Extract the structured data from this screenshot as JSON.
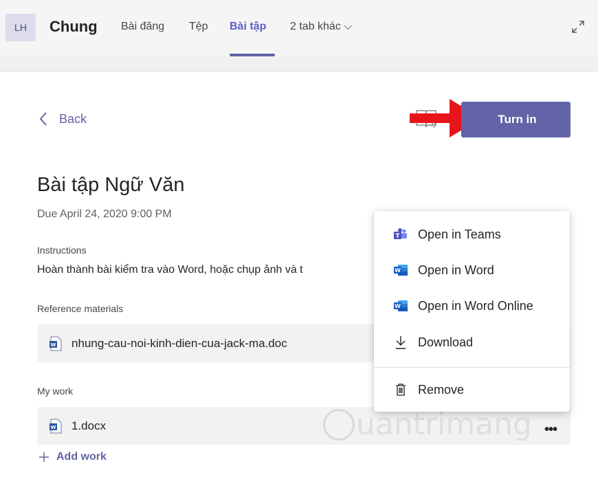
{
  "header": {
    "avatar_initials": "LH",
    "channel_title": "Chung",
    "tabs": [
      {
        "label": "Bài đăng",
        "active": false
      },
      {
        "label": "Tệp",
        "active": false
      },
      {
        "label": "Bài tập",
        "active": true
      },
      {
        "label": "2 tab khác ⌵",
        "active": false
      }
    ]
  },
  "toolbar": {
    "back_label": "Back",
    "turn_in_label": "Turn in"
  },
  "assignment": {
    "title": "Bài tập Ngữ Văn",
    "due": "Due April 24, 2020 9:00 PM",
    "instructions_label": "Instructions",
    "instructions_text": "Hoàn thành bài kiểm tra vào Word, hoặc chụp ảnh và t",
    "reference_label": "Reference materials",
    "reference_file": "nhung-cau-noi-kinh-dien-cua-jack-ma.doc",
    "my_work_label": "My work",
    "my_work_file": "1.docx",
    "add_work_label": "Add work"
  },
  "context_menu": {
    "items": [
      {
        "label": "Open in Teams",
        "icon": "teams-icon"
      },
      {
        "label": "Open in Word",
        "icon": "word-icon"
      },
      {
        "label": "Open in Word Online",
        "icon": "word-icon"
      },
      {
        "label": "Download",
        "icon": "download-icon"
      },
      {
        "label": "Remove",
        "icon": "trash-icon"
      }
    ]
  },
  "watermark": {
    "text": "uantrimang"
  },
  "colors": {
    "accent": "#6264a7",
    "arrow": "#e8141c",
    "word_blue": "#2b579a"
  }
}
